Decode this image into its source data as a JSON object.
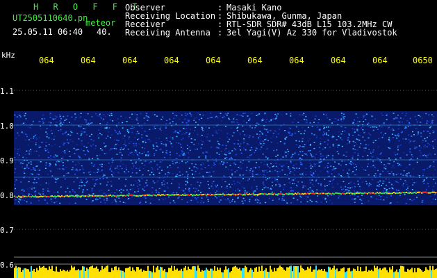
{
  "header": {
    "app_title": "H R O F F T",
    "filename": "UT2505110640.pn",
    "type_label": "meteor",
    "datetime": "25.05.11 06:40",
    "count": "40.",
    "fields": [
      {
        "label": "Observer",
        "value": "Masaki Kano"
      },
      {
        "label": "Receiving Location",
        "value": "Shibukawa, Gunma, Japan"
      },
      {
        "label": "Receiver",
        "value": "RTL-SDR SDR# 43dB L15 103.2MHz CW"
      },
      {
        "label": "Receiving Antenna",
        "value": "3el Yagi(V) Az 330 for Vladivostok"
      }
    ]
  },
  "y_axis": {
    "unit": "kHz",
    "ticks": [
      "1.1",
      "1.0",
      "0.9",
      "0.8",
      "0.7",
      "0.6"
    ]
  },
  "x_axis": {
    "ticks": [
      "064",
      "064",
      "064",
      "064",
      "064",
      "064",
      "064",
      "064",
      "064",
      "0650"
    ]
  },
  "colors": {
    "header_green": "#3ff03f",
    "axis_yellow": "#ffff00",
    "noise_blue": "#1a3cd8",
    "signal_red": "#ff3010"
  }
}
